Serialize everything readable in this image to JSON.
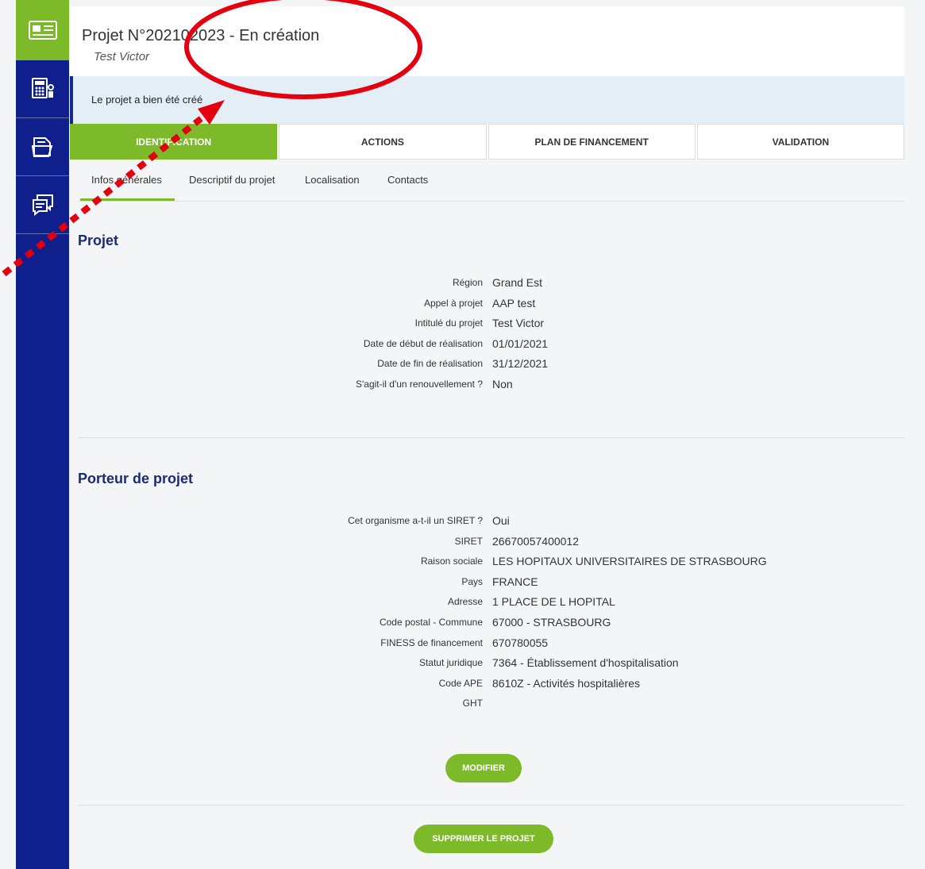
{
  "sidebar": {
    "items": [
      {
        "icon": "id-card-icon"
      },
      {
        "icon": "calculator-icon"
      },
      {
        "icon": "folder-icon"
      },
      {
        "icon": "chat-icon"
      }
    ]
  },
  "header": {
    "title": "Projet N°202102023 - En création",
    "subtitle": "Test Victor"
  },
  "alert": {
    "message": "Le projet a bien été créé"
  },
  "steps": [
    "IDENTIFICATION",
    "ACTIONS",
    "PLAN DE FINANCEMENT",
    "VALIDATION"
  ],
  "subtabs": [
    "Infos générales",
    "Descriptif du projet",
    "Localisation",
    "Contacts"
  ],
  "projet": {
    "title": "Projet",
    "rows": [
      {
        "label": "Région",
        "value": "Grand Est"
      },
      {
        "label": "Appel à projet",
        "value": "AAP test"
      },
      {
        "label": "Intitulé du projet",
        "value": "Test Victor"
      },
      {
        "label": "Date de début de réalisation",
        "value": "01/01/2021"
      },
      {
        "label": "Date de fin de réalisation",
        "value": "31/12/2021"
      },
      {
        "label": "S'agit-il d'un renouvellement ?",
        "value": "Non"
      }
    ]
  },
  "porteur": {
    "title": "Porteur de projet",
    "rows": [
      {
        "label": "Cet organisme a-t-il un SIRET ?",
        "value": "Oui"
      },
      {
        "label": "SIRET",
        "value": "26670057400012"
      },
      {
        "label": "Raison sociale",
        "value": "LES HOPITAUX UNIVERSITAIRES DE STRASBOURG"
      },
      {
        "label": "Pays",
        "value": "FRANCE"
      },
      {
        "label": "Adresse",
        "value": "1 PLACE DE L HOPITAL"
      },
      {
        "label": "Code postal - Commune",
        "value": "67000 - STRASBOURG"
      },
      {
        "label": "FINESS de financement",
        "value": "670780055"
      },
      {
        "label": "Statut juridique",
        "value": "7364 - Établissement d'hospitalisation"
      },
      {
        "label": "Code APE",
        "value": "8610Z - Activités hospitalières"
      },
      {
        "label": "GHT",
        "value": ""
      }
    ]
  },
  "buttons": {
    "modify": "MODIFIER",
    "delete": "SUPPRIMER LE PROJET"
  },
  "colors": {
    "accent": "#7cba2a",
    "sidebar": "#0f1f8c",
    "annotation": "#e3000f"
  }
}
